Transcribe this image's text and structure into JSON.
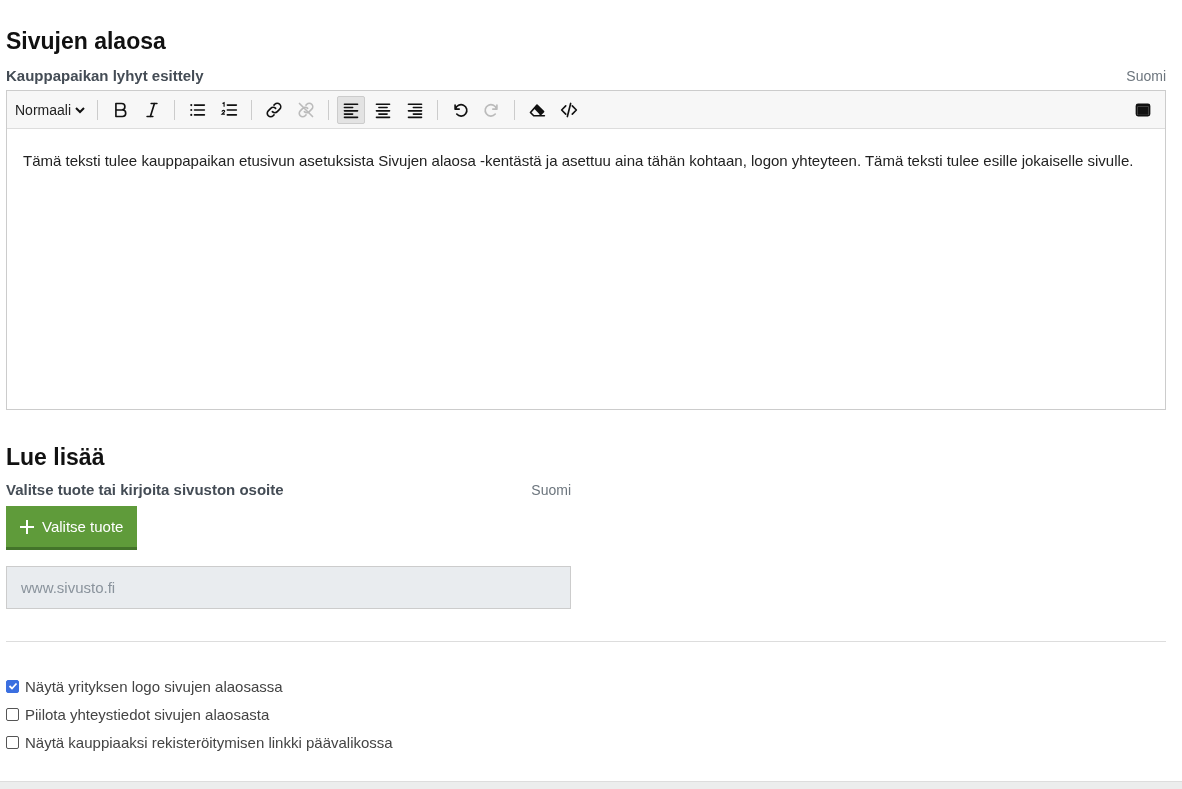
{
  "footer_section": {
    "heading": "Sivujen alaosa",
    "field_label": "Kauppapaikan lyhyt esittely",
    "language": "Suomi",
    "toolbar": {
      "format_dropdown": "Normaali",
      "groups": [
        [
          {
            "kind": "bold",
            "disabled": false,
            "selected": false
          },
          {
            "kind": "italic",
            "disabled": false,
            "selected": false
          }
        ],
        [
          {
            "kind": "bullets",
            "disabled": false,
            "selected": false
          },
          {
            "kind": "numbers",
            "disabled": false,
            "selected": false
          }
        ],
        [
          {
            "kind": "link",
            "disabled": false,
            "selected": false
          },
          {
            "kind": "unlink",
            "disabled": true,
            "selected": false
          }
        ],
        [
          {
            "kind": "alignleft",
            "disabled": false,
            "selected": true
          },
          {
            "kind": "aligncenter",
            "disabled": false,
            "selected": false
          },
          {
            "kind": "alignright",
            "disabled": false,
            "selected": false
          }
        ],
        [
          {
            "kind": "undo",
            "disabled": false,
            "selected": false
          },
          {
            "kind": "redo",
            "disabled": true,
            "selected": false
          }
        ],
        [
          {
            "kind": "eraser",
            "disabled": false,
            "selected": false
          },
          {
            "kind": "code",
            "disabled": false,
            "selected": false
          }
        ]
      ],
      "right": [
        {
          "kind": "fullscreen",
          "disabled": false,
          "selected": false
        }
      ]
    },
    "editor_text": "Tämä teksti tulee kauppapaikan etusivun asetuksista Sivujen alaosa -kentästä ja asettuu aina tähän kohtaan, logon yhteyteen. Tämä teksti tulee esille jokaiselle sivulle."
  },
  "read_more": {
    "heading": "Lue lisää",
    "field_label": "Valitse tuote tai kirjoita sivuston osoite",
    "language": "Suomi",
    "button": "Valitse tuote",
    "url_field": {
      "placeholder": "www.sivusto.fi"
    }
  },
  "options": [
    {
      "label": "Näytä yrityksen logo sivujen alaosassa",
      "checked": true
    },
    {
      "label": "Piilota yhteystiedot sivujen alaosasta",
      "checked": false
    },
    {
      "label": "Näytä kauppiaaksi rekisteröitymisen linkki päävalikossa",
      "checked": false
    }
  ]
}
